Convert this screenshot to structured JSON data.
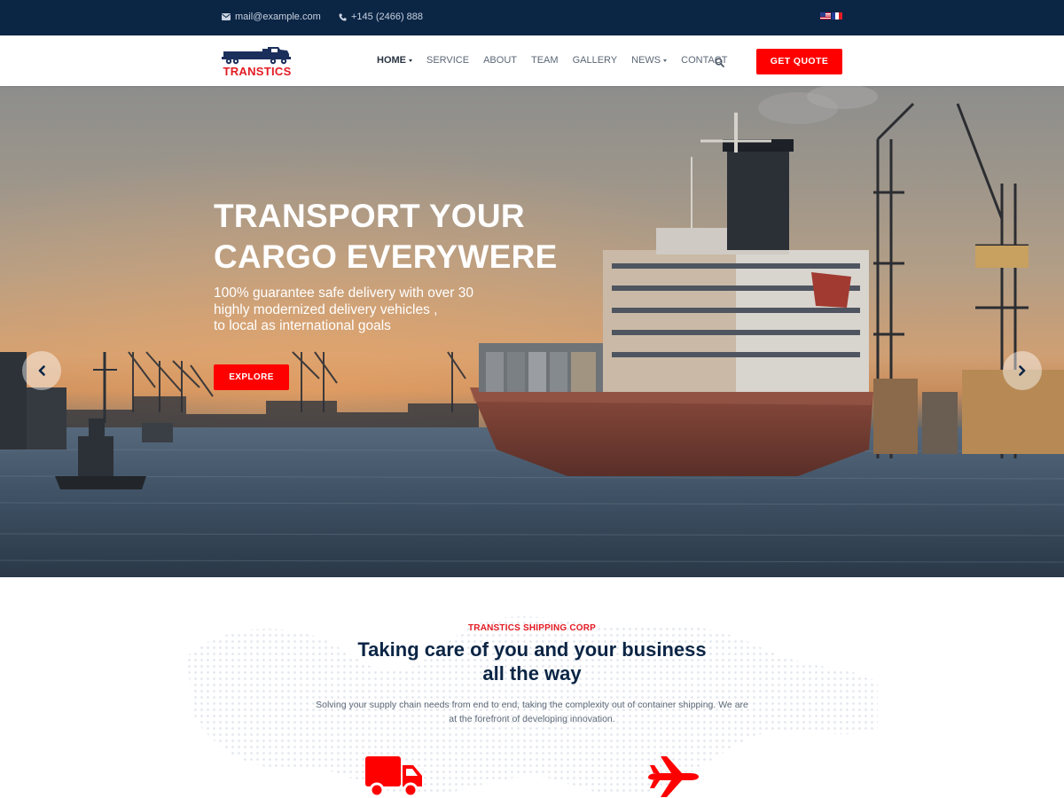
{
  "topbar": {
    "email": "mail@example.com",
    "phone": "+145 (2466) 888",
    "email_icon": "envelope-icon",
    "phone_icon": "phone-icon",
    "languages": [
      "en-flag-icon",
      "fr-flag-icon"
    ]
  },
  "brand": {
    "name": "TRANSTICS",
    "logo_icon": "truck-logo-icon"
  },
  "nav": {
    "items": [
      {
        "label": "HOME",
        "dropdown": true,
        "active": true
      },
      {
        "label": "SERVICE",
        "dropdown": false
      },
      {
        "label": "ABOUT",
        "dropdown": false
      },
      {
        "label": "TEAM",
        "dropdown": false
      },
      {
        "label": "GALLERY",
        "dropdown": false
      },
      {
        "label": "NEWS",
        "dropdown": true
      },
      {
        "label": "CONTACT",
        "dropdown": false
      }
    ],
    "search_icon": "search-icon",
    "cta": "GET QUOTE"
  },
  "hero": {
    "title_line1": "TRANSPORT YOUR",
    "title_line2": "CARGO EVERYWERE",
    "subtitle_line1": "100% guarantee safe delivery with over 30",
    "subtitle_line2": "highly modernized delivery vehicles ,",
    "subtitle_line3": "to local as international goals",
    "cta": "EXPLORE",
    "prev_icon": "chevron-left-icon",
    "next_icon": "chevron-right-icon"
  },
  "intro": {
    "eyebrow": "TRANSTICS SHIPPING CORP",
    "headline_line1": "Taking care of you and your business",
    "headline_line2": "all the way",
    "desc_line1": "Solving your supply chain needs from end to end, taking the complexity out of container shipping. We are",
    "desc_line2": "at the forefront of developing innovation.",
    "service_icons": [
      "truck-icon",
      "airplane-icon"
    ]
  },
  "colors": {
    "topbar": "#0b2545",
    "accent": "#ff0000",
    "heading": "#0b2545",
    "text": "#5b6776"
  }
}
